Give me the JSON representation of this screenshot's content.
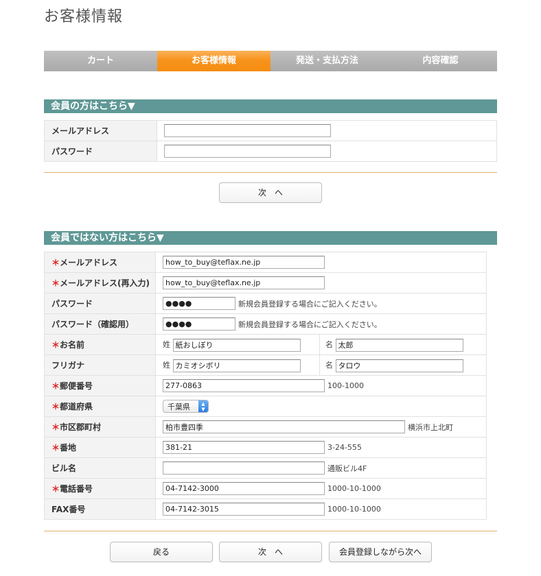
{
  "page": {
    "title": "お客様情報"
  },
  "steps": [
    {
      "label": "カート",
      "active": false
    },
    {
      "label": "お客様情報",
      "active": true
    },
    {
      "label": "発送・支払方法",
      "active": false
    },
    {
      "label": "内容確認",
      "active": false
    }
  ],
  "member": {
    "heading": "会員の方はこちら▼",
    "email_label": "メールアドレス",
    "email_value": "",
    "password_label": "パスワード",
    "password_value": "",
    "next_label": "次　へ"
  },
  "guest": {
    "heading": "会員ではない方はこちら▼",
    "required_mark": "＊",
    "email_label": "メールアドレス",
    "email_value": "how_to_buy@teflax.ne.jp",
    "email_confirm_label": "メールアドレス(再入力)",
    "email_confirm_value": "how_to_buy@teflax.ne.jp",
    "password_label": "パスワード",
    "password_value": "●●●●",
    "password_note": "新規会員登録する場合にご記入ください。",
    "password_confirm_label": "パスワード（確認用）",
    "password_confirm_value": "●●●●",
    "password_confirm_note": "新規会員登録する場合にご記入ください。",
    "name_label": "お名前",
    "sei_label": "姓",
    "sei_value": "紙おしぼり",
    "mei_label": "名",
    "mei_value": "太郎",
    "kana_label": "フリガナ",
    "kana_sei_label": "姓",
    "kana_sei_value": "カミオシボリ",
    "kana_mei_label": "名",
    "kana_mei_value": "タロウ",
    "zip_label": "郵便番号",
    "zip_value": "277-0863",
    "zip_note": "100-1000",
    "pref_label": "都道府県",
    "pref_value": "千葉県",
    "city_label": "市区郡町村",
    "city_value": "柏市豊四季",
    "city_note": "横浜市上北町",
    "address_label": "番地",
    "address_value": "381-21",
    "address_note": "3-24-555",
    "building_label": "ビル名",
    "building_value": "",
    "building_note": "通販ビル4F",
    "tel_label": "電話番号",
    "tel_value": "04-7142-3000",
    "tel_note": "1000-10-1000",
    "fax_label": "FAX番号",
    "fax_value": "04-7142-3015",
    "fax_note": "1000-10-1000"
  },
  "buttons": {
    "back": "戻る",
    "next": "次　へ",
    "register_next": "会員登録しながら次へ"
  },
  "colors": {
    "section_bar": "#5f9896",
    "active_step": "#f7941d",
    "inactive_step": "#b3b3b3",
    "required": "#e02020",
    "rule": "#e1b36a"
  }
}
